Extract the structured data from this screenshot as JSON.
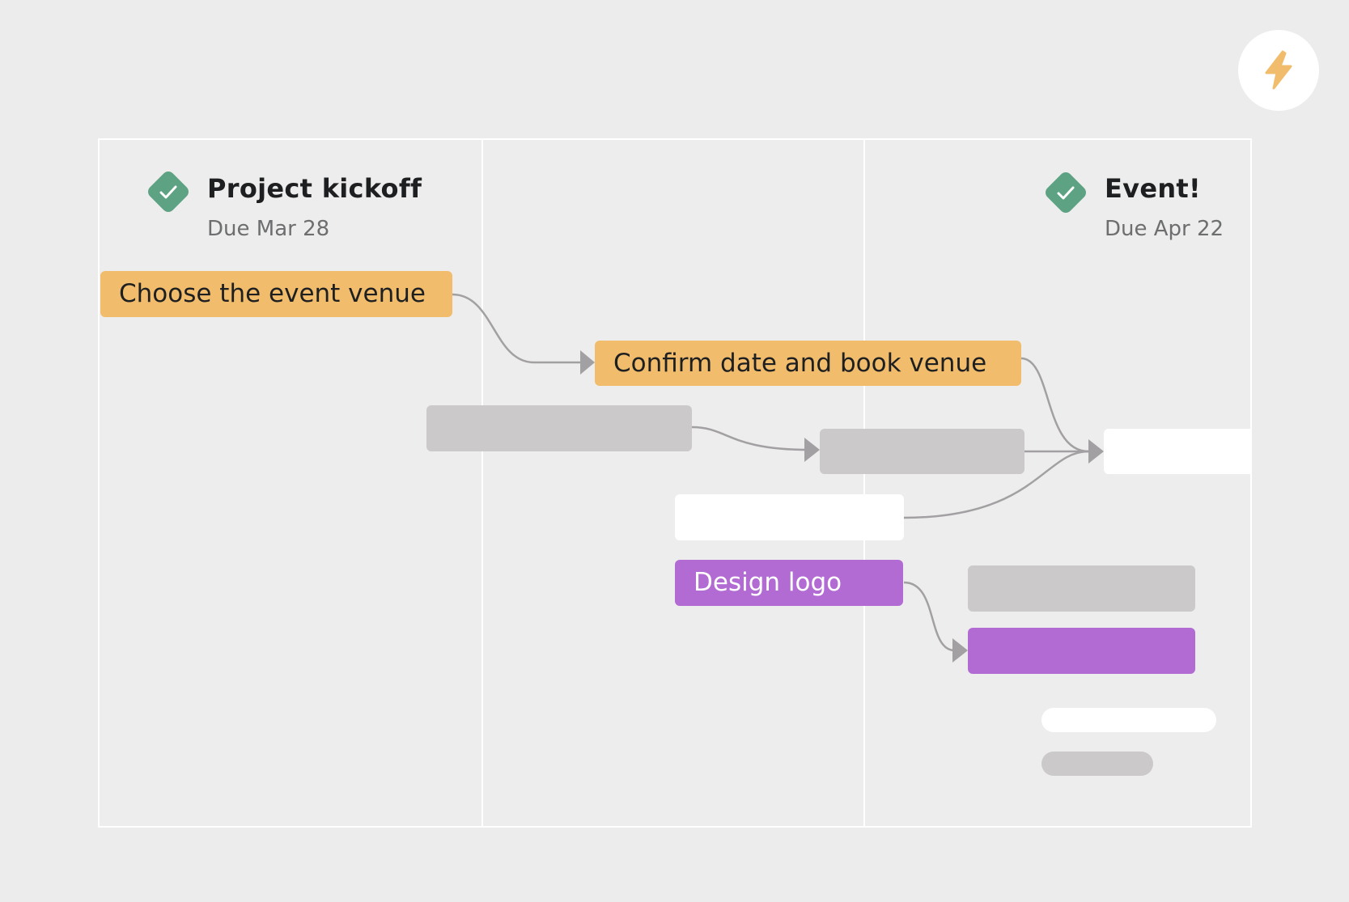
{
  "milestones": [
    {
      "title": "Project kickoff",
      "due": "Due Mar 28",
      "status": "complete",
      "icon": "check-diamond-icon"
    },
    {
      "title": "Event!",
      "due": "Due Apr 22",
      "status": "complete",
      "icon": "check-diamond-icon"
    }
  ],
  "tasks": {
    "choose_venue": "Choose the event venue",
    "confirm_date": "Confirm date and book venue",
    "design_logo": "Design logo"
  },
  "automation_button": {
    "icon": "lightning-bolt-icon"
  },
  "colors": {
    "background": "#EDECEC",
    "orange_task": "#F1BD6C",
    "purple_task": "#B36BD4",
    "placeholder_gray": "#CBC9CA",
    "milestone_green": "#5DA283",
    "connector": "#A2A0A2",
    "bolt": "#F1BD6C"
  }
}
